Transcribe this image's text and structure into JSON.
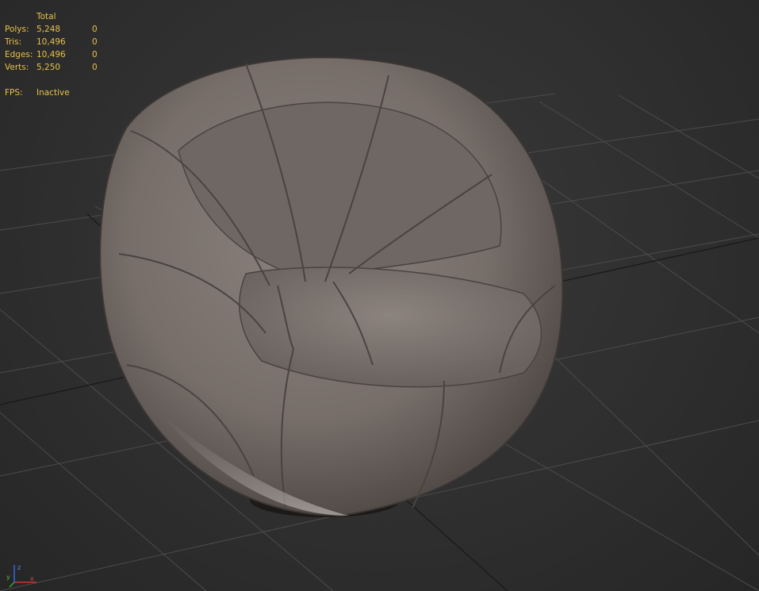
{
  "stats": {
    "header": "Total",
    "rows": [
      {
        "label": "Polys:",
        "total": "5,248",
        "selected": "0"
      },
      {
        "label": "Tris:",
        "total": "10,496",
        "selected": "0"
      },
      {
        "label": "Edges:",
        "total": "10,496",
        "selected": "0"
      },
      {
        "label": "Verts:",
        "total": "5,250",
        "selected": "0"
      }
    ],
    "fps_label": "FPS:",
    "fps_value": "Inactive"
  },
  "axis": {
    "x": "x",
    "y": "y",
    "z": "z"
  },
  "colors": {
    "stats_text": "#e6c24a",
    "grid_line": "#5a5a5a",
    "background": "#2f2f2f",
    "chair_base": "#7d7470"
  }
}
